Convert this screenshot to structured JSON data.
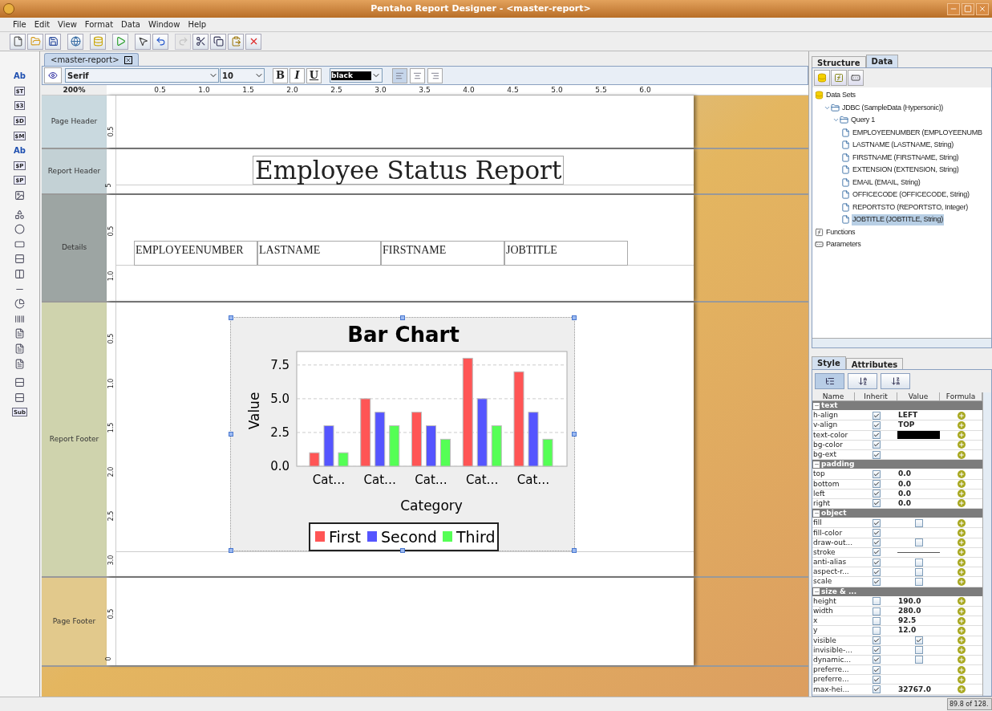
{
  "window": {
    "title": "Pentaho Report Designer - <master-report>"
  },
  "menu": [
    "File",
    "Edit",
    "View",
    "Format",
    "Data",
    "Window",
    "Help"
  ],
  "toolbar": [
    {
      "kind": "new",
      "disabled": false
    },
    {
      "kind": "open",
      "disabled": false
    },
    {
      "kind": "save",
      "disabled": false
    },
    {
      "kind": "publish",
      "disabled": false
    },
    {
      "kind": "datasource",
      "disabled": false
    },
    {
      "kind": "run",
      "disabled": false
    },
    {
      "kind": "pointer",
      "disabled": false
    },
    {
      "kind": "undo",
      "disabled": false
    },
    {
      "kind": "redo",
      "disabled": true
    },
    {
      "kind": "cut",
      "disabled": false
    },
    {
      "kind": "copy",
      "disabled": false
    },
    {
      "kind": "paste",
      "disabled": false
    },
    {
      "kind": "delete",
      "disabled": false
    }
  ],
  "palette": [
    [
      {
        "kind": "blue-text",
        "label": "Ab"
      },
      {
        "kind": "text",
        "label": "$T"
      },
      {
        "kind": "text",
        "label": "$3"
      },
      {
        "kind": "text",
        "label": "$D"
      },
      {
        "kind": "text",
        "label": "$M"
      },
      {
        "kind": "blue-text",
        "label": "Ab"
      },
      {
        "kind": "text",
        "label": "$P"
      },
      {
        "kind": "text",
        "label": "$P"
      },
      {
        "kind": "image"
      }
    ],
    [
      {
        "kind": "shapes"
      },
      {
        "kind": "ellipse"
      },
      {
        "kind": "rectangle"
      },
      {
        "kind": "hline"
      },
      {
        "kind": "vline"
      },
      {
        "kind": "stroke"
      },
      {
        "kind": "chart"
      },
      {
        "kind": "barcode"
      },
      {
        "kind": "doc"
      },
      {
        "kind": "doc"
      },
      {
        "kind": "doc"
      }
    ],
    [
      {
        "kind": "band"
      },
      {
        "kind": "band"
      },
      {
        "kind": "text",
        "label": "Sub"
      }
    ]
  ],
  "document_tab": {
    "label": "<master-report>"
  },
  "format_bar": {
    "font": "Serif",
    "size": "10",
    "styles": [
      {
        "kind": "bold",
        "label": "B"
      },
      {
        "kind": "italic",
        "label": "I"
      },
      {
        "kind": "underline",
        "label": "U"
      }
    ],
    "color_field": "black",
    "align": [
      {
        "kind": "left",
        "selected": true
      },
      {
        "kind": "center",
        "selected": false
      },
      {
        "kind": "right",
        "selected": false
      }
    ]
  },
  "zoom": "200%",
  "ruler": [
    "0.5",
    "1.0",
    "1.5",
    "2.0",
    "2.5",
    "3.0",
    "3.5",
    "4.0",
    "4.5",
    "5.0",
    "5.5",
    "6.0"
  ],
  "bands": [
    {
      "kind": "page-header",
      "label": "Page Header",
      "ruler": [
        "0.5"
      ]
    },
    {
      "kind": "report-header",
      "label": "Report Header",
      "ruler": [
        "5"
      ],
      "title": "Employee Status Report"
    },
    {
      "kind": "details",
      "label": "Details",
      "ruler": [
        "0.5",
        "1.0"
      ],
      "fields": [
        "EMPLOYEENUMBER",
        "LASTNAME",
        "FIRSTNAME",
        "JOBTITLE"
      ]
    },
    {
      "kind": "report-footer",
      "label": "Report Footer",
      "ruler": [
        "0.5",
        "1.0",
        "1.5",
        "2.0",
        "2.5",
        "3.0"
      ],
      "chart_data": {
        "type": "bar",
        "title": "Bar Chart",
        "xlabel": "Category",
        "ylabel": "Value",
        "categories": [
          "Cat…",
          "Cat…",
          "Cat…",
          "Cat…",
          "Cat…"
        ],
        "series": [
          {
            "name": "First",
            "color": "#ff5555",
            "values": [
              1,
              5,
              4,
              8,
              7
            ]
          },
          {
            "name": "Second",
            "color": "#5555ff",
            "values": [
              3,
              4,
              3,
              5,
              4
            ]
          },
          {
            "name": "Third",
            "color": "#55ff55",
            "values": [
              1,
              3,
              2,
              3,
              2
            ]
          }
        ],
        "ylim": [
          0,
          8.5
        ],
        "yticks": [
          {
            "value": 0,
            "label": "0.0"
          },
          {
            "value": 2.5,
            "label": "2.5"
          },
          {
            "value": 5,
            "label": "5.0"
          },
          {
            "value": 7.5,
            "label": "7.5"
          }
        ],
        "grid": true,
        "legend": true
      }
    },
    {
      "kind": "page-footer",
      "label": "Page Footer",
      "ruler": [
        "0.5",
        "0"
      ]
    }
  ],
  "top_panel": {
    "tabs": [
      {
        "label": "Structure",
        "selected": false
      },
      {
        "label": "Data",
        "selected": true
      }
    ],
    "tools": [
      {
        "kind": "datasource"
      },
      {
        "kind": "function"
      },
      {
        "kind": "parameter"
      }
    ],
    "tree": [
      {
        "label": "Data Sets",
        "kind": "database",
        "selected": false,
        "children": [
          {
            "label": "JDBC (SampleData (Hypersonic))",
            "kind": "folder",
            "expanded": true,
            "selected": false,
            "children": [
              {
                "label": "Query 1",
                "kind": "folder",
                "expanded": true,
                "selected": false,
                "children": [
                  {
                    "label": "EMPLOYEENUMBER (EMPLOYEENUMB",
                    "kind": "field",
                    "selected": false
                  },
                  {
                    "label": "LASTNAME (LASTNAME, String)",
                    "kind": "field",
                    "selected": false
                  },
                  {
                    "label": "FIRSTNAME (FIRSTNAME, String)",
                    "kind": "field",
                    "selected": false
                  },
                  {
                    "label": "EXTENSION (EXTENSION, String)",
                    "kind": "field",
                    "selected": false
                  },
                  {
                    "label": "EMAIL (EMAIL, String)",
                    "kind": "field",
                    "selected": false
                  },
                  {
                    "label": "OFFICECODE (OFFICECODE, String)",
                    "kind": "field",
                    "selected": false
                  },
                  {
                    "label": "REPORTSTO (REPORTSTO, Integer)",
                    "kind": "field",
                    "selected": false
                  },
                  {
                    "label": "JOBTITLE (JOBTITLE, String)",
                    "kind": "field",
                    "selected": true
                  }
                ]
              }
            ]
          }
        ]
      },
      {
        "label": "Functions",
        "kind": "function",
        "selected": false
      },
      {
        "label": "Parameters",
        "kind": "parameter",
        "selected": false
      }
    ]
  },
  "style_panel": {
    "tabs": [
      {
        "label": "Style",
        "selected": true
      },
      {
        "label": "Attributes",
        "selected": false
      }
    ],
    "tools": [
      {
        "kind": "grouped",
        "selected": true
      },
      {
        "kind": "sort-asc",
        "selected": false
      },
      {
        "kind": "sort-desc",
        "selected": false
      }
    ],
    "columns": [
      "Name",
      "Inherit",
      "Value",
      "Formula"
    ],
    "rows": [
      {
        "kind": "group",
        "name": "text"
      },
      {
        "kind": "text",
        "name": "h-align",
        "inherit": true,
        "value": "LEFT"
      },
      {
        "kind": "text",
        "name": "v-align",
        "inherit": true,
        "value": "TOP"
      },
      {
        "kind": "color",
        "name": "text-color",
        "inherit": true,
        "color": "#000000"
      },
      {
        "kind": "empty",
        "name": "bg-color",
        "inherit": true
      },
      {
        "kind": "empty",
        "name": "bg-ext",
        "inherit": true
      },
      {
        "kind": "group",
        "name": "padding"
      },
      {
        "kind": "text",
        "name": "top",
        "inherit": true,
        "value": "0.0"
      },
      {
        "kind": "text",
        "name": "bottom",
        "inherit": true,
        "value": "0.0"
      },
      {
        "kind": "text",
        "name": "left",
        "inherit": true,
        "value": "0.0"
      },
      {
        "kind": "text",
        "name": "right",
        "inherit": true,
        "value": "0.0"
      },
      {
        "kind": "group",
        "name": "object"
      },
      {
        "kind": "check",
        "name": "fill",
        "inherit": true,
        "checked": false
      },
      {
        "kind": "empty",
        "name": "fill-color",
        "inherit": true
      },
      {
        "kind": "check",
        "name": "draw-out...",
        "inherit": true,
        "checked": false
      },
      {
        "kind": "stroke",
        "name": "stroke",
        "inherit": true
      },
      {
        "kind": "check",
        "name": "anti-alias",
        "inherit": true,
        "checked": false
      },
      {
        "kind": "check",
        "name": "aspect-r...",
        "inherit": true,
        "checked": false
      },
      {
        "kind": "check",
        "name": "scale",
        "inherit": true,
        "checked": false
      },
      {
        "kind": "group",
        "name": "size & ..."
      },
      {
        "kind": "text",
        "name": "height",
        "inherit": false,
        "value": "190.0"
      },
      {
        "kind": "text",
        "name": "width",
        "inherit": false,
        "value": "280.0"
      },
      {
        "kind": "text",
        "name": "x",
        "inherit": false,
        "value": "92.5"
      },
      {
        "kind": "text",
        "name": "y",
        "inherit": false,
        "value": "12.0"
      },
      {
        "kind": "check",
        "name": "visible",
        "inherit": true,
        "checked": true
      },
      {
        "kind": "check",
        "name": "invisible-...",
        "inherit": true,
        "checked": false
      },
      {
        "kind": "check",
        "name": "dynamic...",
        "inherit": true,
        "checked": false
      },
      {
        "kind": "empty",
        "name": "preferre...",
        "inherit": true
      },
      {
        "kind": "empty",
        "name": "preferre...",
        "inherit": true
      },
      {
        "kind": "text",
        "name": "max-hei...",
        "inherit": true,
        "value": "32767.0"
      }
    ]
  },
  "status_bar": {
    "memory": "89.8 of 128."
  }
}
